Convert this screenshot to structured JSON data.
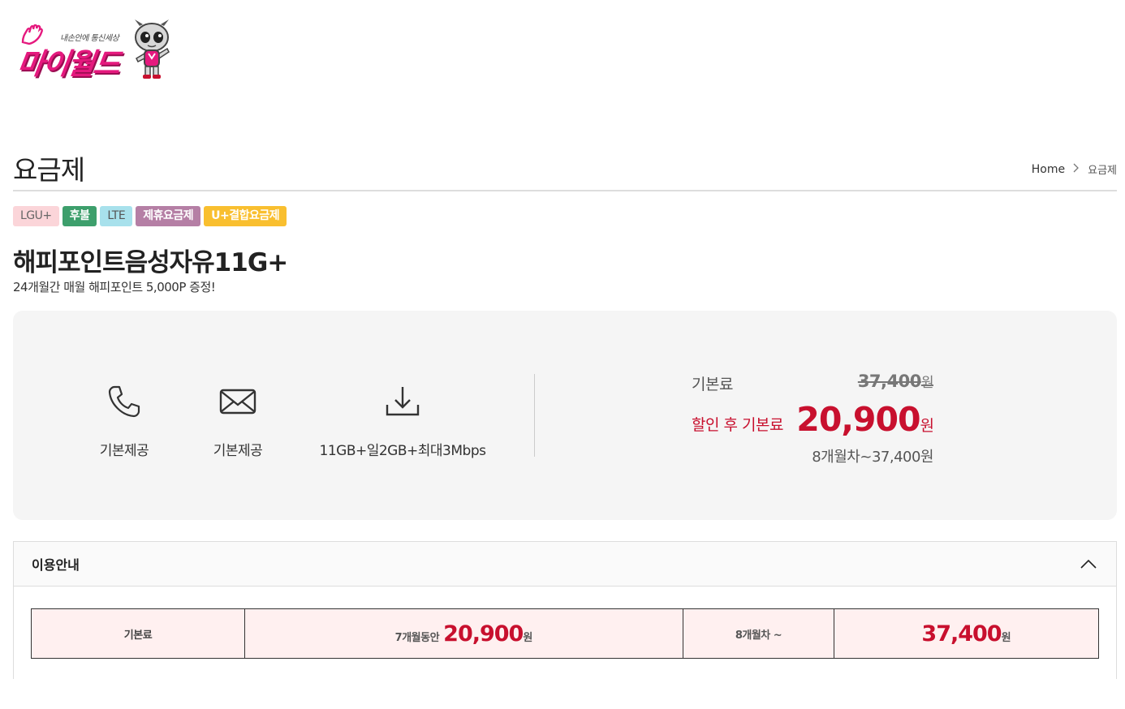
{
  "logo": {
    "brand": "마이월드",
    "tagline": "내손안에 통신세상"
  },
  "page": {
    "title": "요금제"
  },
  "breadcrumb": {
    "home": "Home",
    "current": "요금제"
  },
  "tags": [
    {
      "label": "LGU+",
      "color": "#fbd5d9"
    },
    {
      "label": "후불",
      "color": "#3d9f6c"
    },
    {
      "label": "LTE",
      "color": "#a8e1ec"
    },
    {
      "label": "제휴요금제",
      "color": "#b57fa5"
    },
    {
      "label": "U+결합요금제",
      "color": "#f9bf2f"
    }
  ],
  "plan": {
    "name": "해피포인트음성자유11G+",
    "description": "24개월간 매월 해피포인트 5,000P 증정!"
  },
  "features": {
    "call": {
      "icon": "phone-icon",
      "label": "기본제공"
    },
    "sms": {
      "icon": "envelope-icon",
      "label": "기본제공"
    },
    "data": {
      "icon": "download-icon",
      "label": "11GB+일2GB+최대3Mbps"
    }
  },
  "pricing": {
    "base_label": "기본료",
    "base_value": "37,400",
    "won": "원",
    "discount_label": "할인 후 기본료",
    "discount_value": "20,900",
    "after_note": "8개월차~37,400원"
  },
  "usage": {
    "title": "이용안내",
    "table": {
      "label": "기본료",
      "period1_prefix": "7개월동안",
      "period1_value": "20,900",
      "period2_label": "8개월차 ~",
      "period2_value": "37,400",
      "unit": "원"
    }
  },
  "colors": {
    "accent": "#c8102e",
    "brand": "#e5197e",
    "panel_bg": "#f5f5f5",
    "table_bg": "#fff0f0"
  }
}
